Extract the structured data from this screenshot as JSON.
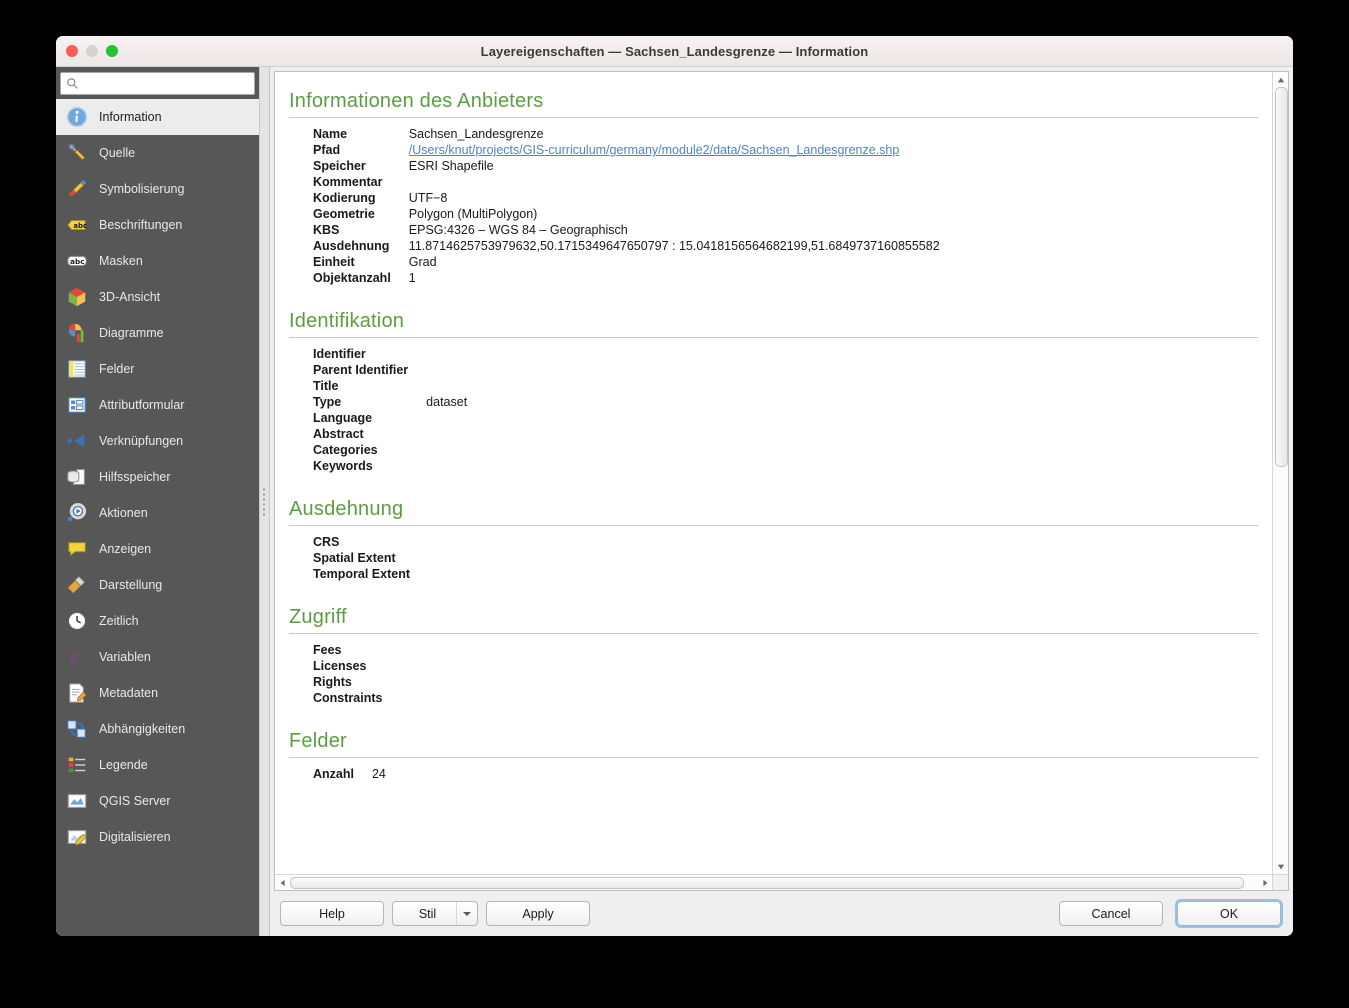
{
  "window": {
    "title": "Layereigenschaften  — Sachsen_Landesgrenze — Information",
    "traffic": {
      "close": "close-button",
      "minimize": "minimize-button",
      "zoom": "zoom-button"
    }
  },
  "sidebar": {
    "search": {
      "value": "",
      "placeholder": ""
    },
    "items": [
      {
        "label": "Information",
        "icon": "info-icon",
        "selected": true
      },
      {
        "label": "Quelle",
        "icon": "wrench-icon",
        "selected": false
      },
      {
        "label": "Symbolisierung",
        "icon": "paintbrush-icon",
        "selected": false
      },
      {
        "label": "Beschriftungen",
        "icon": "label-abc-icon",
        "selected": false
      },
      {
        "label": "Masken",
        "icon": "mask-abc-icon",
        "selected": false
      },
      {
        "label": "3D-Ansicht",
        "icon": "cube-3d-icon",
        "selected": false
      },
      {
        "label": "Diagramme",
        "icon": "chart-icon",
        "selected": false
      },
      {
        "label": "Felder",
        "icon": "table-fields-icon",
        "selected": false
      },
      {
        "label": "Attributformular",
        "icon": "form-icon",
        "selected": false
      },
      {
        "label": "Verknüpfungen",
        "icon": "join-icon",
        "selected": false
      },
      {
        "label": "Hilfsspeicher",
        "icon": "database-icon",
        "selected": false
      },
      {
        "label": "Aktionen",
        "icon": "gear-play-icon",
        "selected": false
      },
      {
        "label": "Anzeigen",
        "icon": "speech-bubble-icon",
        "selected": false
      },
      {
        "label": "Darstellung",
        "icon": "broom-icon",
        "selected": false
      },
      {
        "label": "Zeitlich",
        "icon": "clock-icon",
        "selected": false
      },
      {
        "label": "Variablen",
        "icon": "epsilon-icon",
        "selected": false
      },
      {
        "label": "Metadaten",
        "icon": "document-pencil-icon",
        "selected": false
      },
      {
        "label": "Abhängigkeiten",
        "icon": "dependencies-icon",
        "selected": false
      },
      {
        "label": "Legende",
        "icon": "legend-icon",
        "selected": false
      },
      {
        "label": "QGIS Server",
        "icon": "server-map-icon",
        "selected": false
      },
      {
        "label": "Digitalisieren",
        "icon": "digitize-pencil-icon",
        "selected": false
      }
    ]
  },
  "content": {
    "sections": [
      {
        "title": "Informationen des Anbieters",
        "rows": [
          {
            "key": "Name",
            "value": "Sachsen_Landesgrenze",
            "link": false
          },
          {
            "key": "Pfad",
            "value": "/Users/knut/projects/GIS-curriculum/germany/module2/data/Sachsen_Landesgrenze.shp",
            "link": true
          },
          {
            "key": "Speicher",
            "value": "ESRI Shapefile",
            "link": false
          },
          {
            "key": "Kommentar",
            "value": "",
            "link": false
          },
          {
            "key": "Kodierung",
            "value": "UTF−8",
            "link": false
          },
          {
            "key": "Geometrie",
            "value": "Polygon (MultiPolygon)",
            "link": false
          },
          {
            "key": "KBS",
            "value": "EPSG:4326 – WGS 84 – Geographisch",
            "link": false
          },
          {
            "key": "Ausdehnung",
            "value": "11.8714625753979632,50.1715349647650797 : 15.0418156564682199,51.6849737160855582",
            "link": false
          },
          {
            "key": "Einheit",
            "value": "Grad",
            "link": false
          },
          {
            "key": "Objektanzahl",
            "value": "1",
            "link": false
          }
        ]
      },
      {
        "title": "Identifikation",
        "rows": [
          {
            "key": "Identifier",
            "value": "",
            "link": false
          },
          {
            "key": "Parent Identifier",
            "value": "",
            "link": false
          },
          {
            "key": "Title",
            "value": "",
            "link": false
          },
          {
            "key": "Type",
            "value": "dataset",
            "link": false
          },
          {
            "key": "Language",
            "value": "",
            "link": false
          },
          {
            "key": "Abstract",
            "value": "",
            "link": false
          },
          {
            "key": "Categories",
            "value": "",
            "link": false
          },
          {
            "key": "Keywords",
            "value": "",
            "link": false
          }
        ]
      },
      {
        "title": "Ausdehnung",
        "rows": [
          {
            "key": "CRS",
            "value": "",
            "link": false
          },
          {
            "key": "Spatial Extent",
            "value": "",
            "link": false
          },
          {
            "key": "Temporal Extent",
            "value": "",
            "link": false
          }
        ]
      },
      {
        "title": "Zugriff",
        "rows": [
          {
            "key": "Fees",
            "value": "",
            "link": false
          },
          {
            "key": "Licenses",
            "value": "",
            "link": false
          },
          {
            "key": "Rights",
            "value": "",
            "link": false
          },
          {
            "key": "Constraints",
            "value": "",
            "link": false
          }
        ]
      },
      {
        "title": "Felder",
        "rows": [
          {
            "key": "Anzahl",
            "value": "24",
            "link": false
          }
        ]
      }
    ]
  },
  "buttons": {
    "help": "Help",
    "style": "Stil",
    "apply": "Apply",
    "cancel": "Cancel",
    "ok": "OK"
  },
  "colors": {
    "heading_green": "#5a9e41",
    "link_blue": "#4a86c8",
    "sidebar_bg": "#575757",
    "selected_bg": "#ececec",
    "focus_ring": "#5a96d7"
  }
}
